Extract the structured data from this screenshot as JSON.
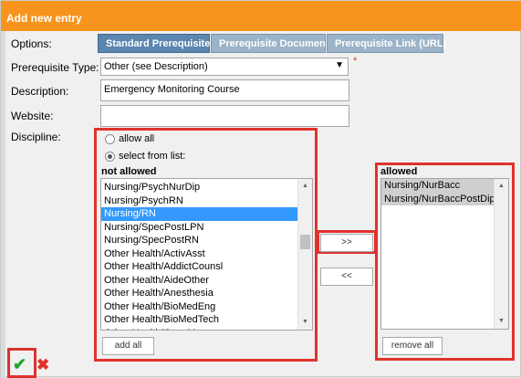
{
  "dialog": {
    "title": "Add new entry"
  },
  "labels": {
    "options": "Options:",
    "prerequisite_type": "Prerequisite Type:",
    "description": "Description:",
    "website": "Website:",
    "discipline": "Discipline:"
  },
  "tabs": [
    {
      "label": "Standard Prerequisite",
      "active": true
    },
    {
      "label": "Prerequisite Document",
      "active": false
    },
    {
      "label": "Prerequisite Link (URL)",
      "active": false
    }
  ],
  "prerequisite_type": {
    "value": "Other (see Description)",
    "required_marker": "*"
  },
  "description": {
    "value": "Emergency Monitoring Course"
  },
  "website": {
    "value": ""
  },
  "discipline": {
    "allow_all_label": "allow all",
    "select_from_list_label": "select from list:",
    "selected_option": "select from list",
    "not_allowed_header": "not allowed",
    "allowed_header": "allowed",
    "not_allowed_items": [
      "Nursing/PsychNurDip",
      "Nursing/PsychRN",
      "Nursing/RN",
      "Nursing/SpecPostLPN",
      "Nursing/SpecPostRN",
      "Other Health/ActivAsst",
      "Other Health/AddictCounsl",
      "Other Health/AideOther",
      "Other Health/Anesthesia",
      "Other Health/BioMedEng",
      "Other Health/BioMedTech",
      "Other Health/CaseManager"
    ],
    "not_allowed_selected": "Nursing/RN",
    "allowed_items": [
      "Nursing/NurBacc",
      "Nursing/NurBaccPostDip"
    ],
    "add_label": ">>",
    "remove_label": "<<",
    "add_all_label": "add all",
    "remove_all_label": "remove all"
  },
  "footer": {
    "ok_icon": "checkmark-icon",
    "cancel_icon": "x-icon"
  },
  "colors": {
    "title_bar": "#f7941d",
    "tab_active": "#5b86b0",
    "tab_inactive": "#9bb3c9",
    "highlight_box": "#e0322d",
    "selection": "#3399ff",
    "ok": "#22a32a",
    "cancel": "#e0322d"
  }
}
